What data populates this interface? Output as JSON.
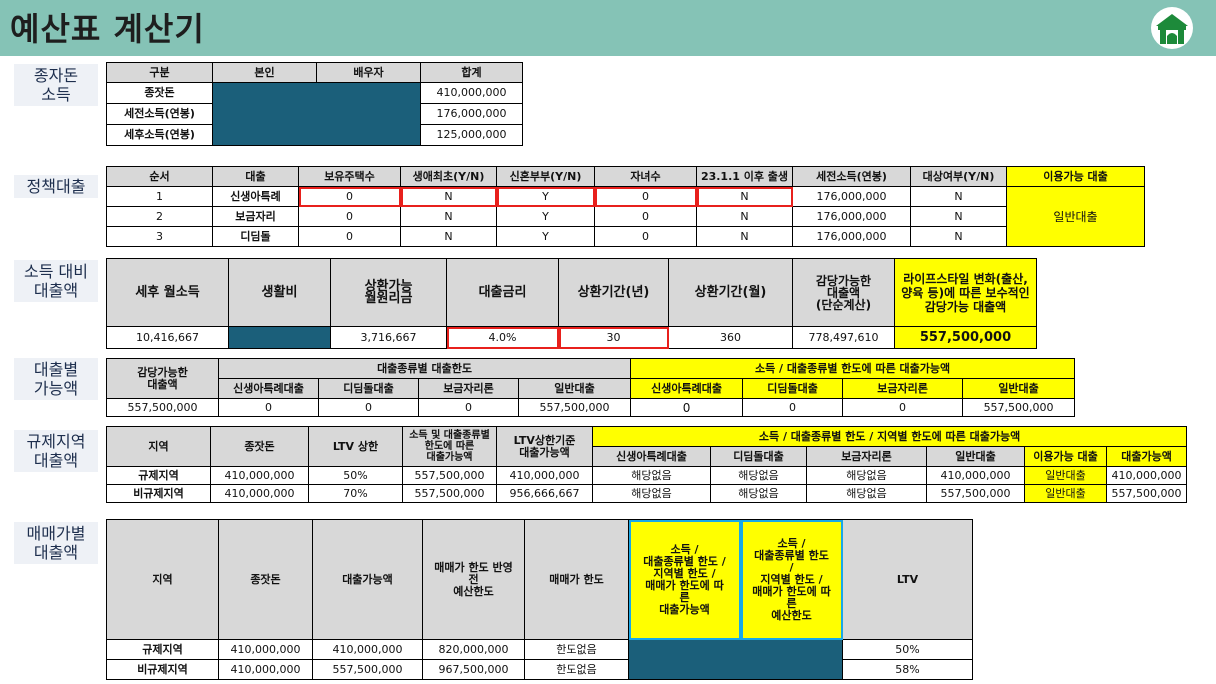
{
  "header": {
    "title": "예산표 계산기",
    "logo_icon": "building-gate-logo-icon"
  },
  "colors": {
    "header_bg": "#85c3b6",
    "highlight": "#ffff00",
    "input": "#1b5f7a",
    "input_border": "#e8201c",
    "header_cell": "#d8d8d8"
  },
  "sec1": {
    "label": "종자돈\n소득",
    "headers": [
      "구분",
      "본인",
      "배우자",
      "합계"
    ],
    "rows": [
      {
        "label": "종잣돈",
        "total": "410,000,000"
      },
      {
        "label": "세전소득(연봉)",
        "total": "176,000,000"
      },
      {
        "label": "세후소득(연봉)",
        "total": "125,000,000"
      }
    ]
  },
  "sec2": {
    "label": "정책대출",
    "headers": [
      "순서",
      "대출",
      "보유주택수",
      "생애최초(Y/N)",
      "신혼부부(Y/N)",
      "자녀수",
      "23.1.1 이후 출생",
      "세전소득(연봉)",
      "대상여부(Y/N)",
      "이용가능 대출"
    ],
    "rows": [
      [
        "1",
        "신생아특례",
        "0",
        "N",
        "Y",
        "0",
        "N",
        "176,000,000",
        "N"
      ],
      [
        "2",
        "보금자리",
        "0",
        "N",
        "Y",
        "0",
        "N",
        "176,000,000",
        "N"
      ],
      [
        "3",
        "디딤돌",
        "0",
        "N",
        "Y",
        "0",
        "N",
        "176,000,000",
        "N"
      ]
    ],
    "available": "일반대출"
  },
  "sec3": {
    "label": "소득 대비\n대출액",
    "headers": [
      "세후 월소득",
      "생활비",
      "상환가능\n월원리금",
      "대출금리",
      "상환기간(년)",
      "상환기간(월)",
      "감당가능한\n대출액\n(단순계산)",
      "라이프스타일 변화(출산, 양육 등)에 따른 보수적인\n감당가능 대출액"
    ],
    "values": [
      "10,416,667",
      "",
      "3,716,667",
      "4.0%",
      "30",
      "360",
      "778,497,610",
      "557,500,000"
    ]
  },
  "sec4": {
    "label": "대출별\n가능액",
    "head_a": "감당가능한\n대출액",
    "head_b": "대출종류별 대출한도",
    "head_c": "소득 / 대출종류별 한도에 따른 대출가능액",
    "subs_b": [
      "신생아특례대출",
      "디딤돌대출",
      "보금자리론",
      "일반대출"
    ],
    "subs_c": [
      "신생아특례대출",
      "디딤돌대출",
      "보금자리론",
      "일반대출"
    ],
    "values": [
      "557,500,000",
      "0",
      "0",
      "0",
      "557,500,000",
      "0",
      "0",
      "0",
      "557,500,000"
    ]
  },
  "sec5": {
    "label": "규제지역\n대출액",
    "headers": [
      "지역",
      "종잣돈",
      "LTV 상한",
      "소득 및 대출종류별\n한도에 따른\n대출가능액",
      "LTV상한기준\n대출가능액"
    ],
    "head_group": "소득 / 대출종류별 한도 / 지역별 한도에 따른 대출가능액",
    "subs": [
      "신생아특례대출",
      "디딤돌대출",
      "보금자리론",
      "일반대출",
      "이용가능 대출",
      "대출가능액"
    ],
    "rows": [
      [
        "규제지역",
        "410,000,000",
        "50%",
        "557,500,000",
        "410,000,000",
        "해당없음",
        "해당없음",
        "해당없음",
        "410,000,000",
        "일반대출",
        "410,000,000"
      ],
      [
        "비규제지역",
        "410,000,000",
        "70%",
        "557,500,000",
        "956,666,667",
        "해당없음",
        "해당없음",
        "해당없음",
        "557,500,000",
        "일반대출",
        "557,500,000"
      ]
    ]
  },
  "sec6": {
    "label": "매매가별\n대출액",
    "headers": [
      "지역",
      "종잣돈",
      "대출가능액",
      "매매가 한도 반영\n전\n예산한도",
      "매매가 한도",
      "소득 /\n대출종류별 한도 /\n지역별 한도 /\n매매가 한도에 따\n른\n대출가능액",
      "소득 /\n대출종류별 한도\n/\n지역별 한도 /\n매매가 한도에 따\n른\n예산한도",
      "LTV"
    ],
    "rows": [
      [
        "규제지역",
        "410,000,000",
        "410,000,000",
        "820,000,000",
        "한도없음",
        "50%"
      ],
      [
        "비규제지역",
        "410,000,000",
        "557,500,000",
        "967,500,000",
        "한도없음",
        "58%"
      ]
    ]
  }
}
